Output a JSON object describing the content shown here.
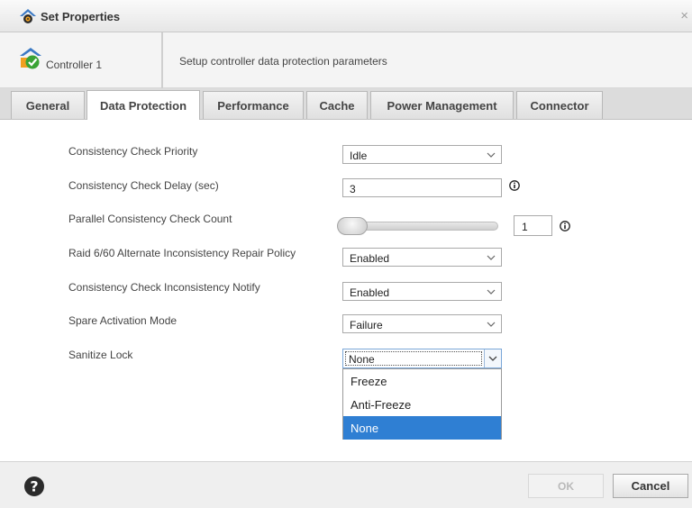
{
  "window": {
    "title": "Set Properties",
    "close_glyph": "×"
  },
  "header": {
    "controller": "Controller 1",
    "description": "Setup controller data protection parameters"
  },
  "tabs": [
    {
      "label": "General"
    },
    {
      "label": "Data Protection",
      "active": true
    },
    {
      "label": "Performance"
    },
    {
      "label": "Cache"
    },
    {
      "label": "Power Management"
    },
    {
      "label": "Connector"
    }
  ],
  "form": {
    "cc_priority": {
      "label": "Consistency Check Priority",
      "value": "Idle"
    },
    "cc_delay": {
      "label": "Consistency Check Delay (sec)",
      "value": "3"
    },
    "parallel_cc": {
      "label": "Parallel Consistency Check Count",
      "value": "1"
    },
    "raid_repair": {
      "label": "Raid 6/60 Alternate Inconsistency Repair Policy",
      "value": "Enabled"
    },
    "cc_notify": {
      "label": "Consistency Check Inconsistency Notify",
      "value": "Enabled"
    },
    "spare_mode": {
      "label": "Spare Activation Mode",
      "value": "Failure"
    },
    "sanitize_lock": {
      "label": "Sanitize Lock",
      "value": "None",
      "options": [
        "Freeze",
        "Anti-Freeze",
        "None"
      ],
      "selected_option": "None"
    }
  },
  "footer": {
    "ok_label": "OK",
    "cancel_label": "Cancel"
  },
  "colors": {
    "accent": "#2f7fd3",
    "icon_orange": "#f0a020",
    "icon_green": "#3aa335"
  },
  "icons": {
    "app": "gear-house-icon",
    "controller": "controller-check-icon",
    "help": "help-icon",
    "info": "info-icon"
  }
}
